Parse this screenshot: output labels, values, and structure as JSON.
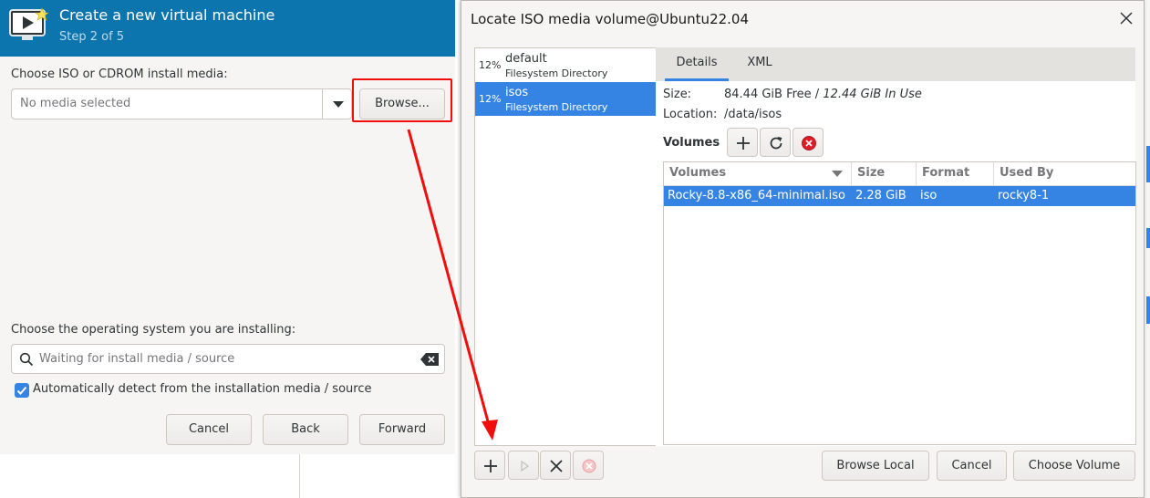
{
  "wizard": {
    "title": "Create a new virtual machine",
    "step": "Step 2 of 5",
    "iso_label": "Choose ISO or CDROM install media:",
    "media_placeholder": "No media selected",
    "browse_label": "Browse...",
    "os_label": "Choose the operating system you are installing:",
    "os_search_placeholder": "Waiting for install media / source",
    "auto_detect_label": "Automatically detect from the installation media / source",
    "auto_detect_checked": true,
    "cancel_label": "Cancel",
    "back_label": "Back",
    "forward_label": "Forward"
  },
  "dialog": {
    "title": "Locate ISO media volume@Ubuntu22.04",
    "pools": [
      {
        "percent": "12%",
        "name": "default",
        "type": "Filesystem Directory",
        "selected": false
      },
      {
        "percent": "12%",
        "name": "isos",
        "type": "Filesystem Directory",
        "selected": true
      }
    ],
    "tabs": [
      "Details",
      "XML"
    ],
    "active_tab": "Details",
    "details": {
      "size_label": "Size:",
      "size_free": "84.44 GiB Free / ",
      "size_in_use": "12.44 GiB In Use",
      "location_label": "Location:",
      "location_value": "/data/isos",
      "volumes_label": "Volumes"
    },
    "table": {
      "columns": [
        "Volumes",
        "Size",
        "Format",
        "Used By"
      ],
      "rows": [
        {
          "name": "Rocky-8.8-x86_64-minimal.iso",
          "size": "2.28 GiB",
          "format": "iso",
          "used_by": "rocky8-1",
          "selected": true
        }
      ]
    },
    "buttons": {
      "browse_local": "Browse Local",
      "cancel": "Cancel",
      "choose_volume": "Choose Volume"
    }
  },
  "colors": {
    "header_blue": "#0c75ae",
    "selection_blue": "#3584e4",
    "annotation_red": "#f20d0d"
  }
}
